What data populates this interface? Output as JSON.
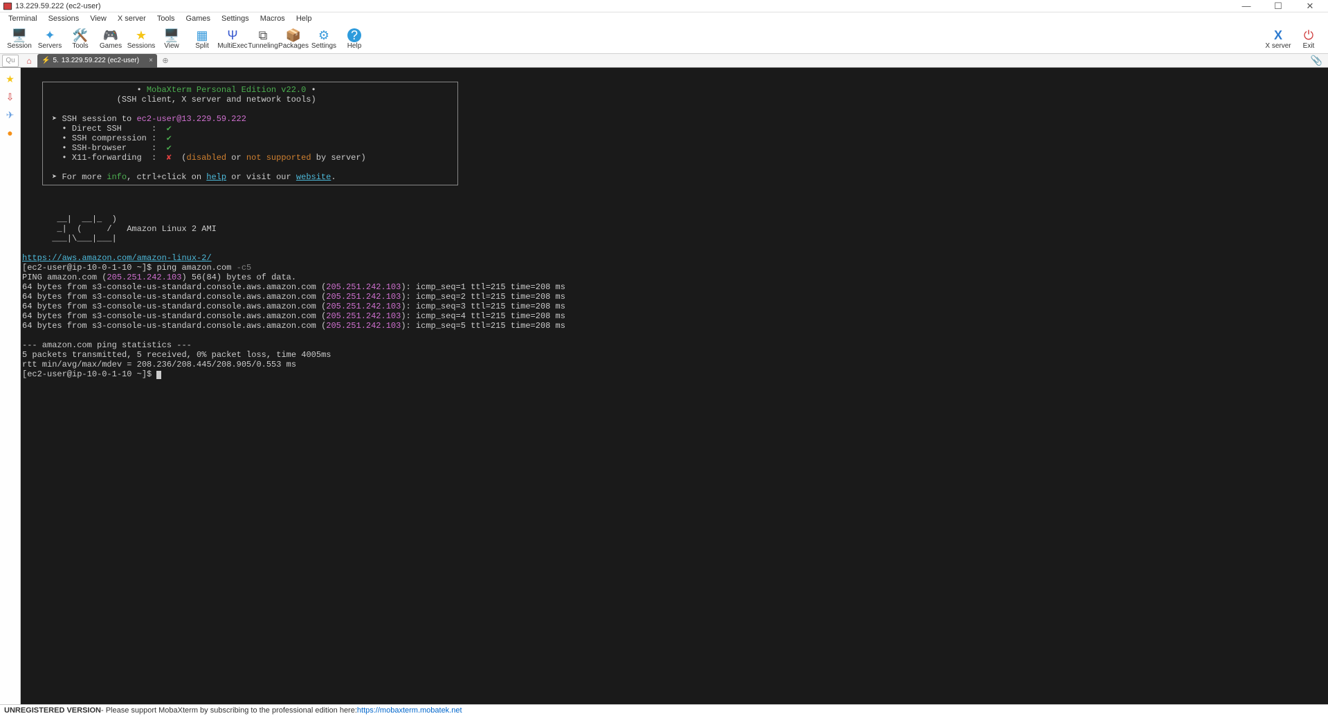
{
  "window": {
    "title": "13.229.59.222 (ec2-user)"
  },
  "menu": [
    "Terminal",
    "Sessions",
    "View",
    "X server",
    "Tools",
    "Games",
    "Settings",
    "Macros",
    "Help"
  ],
  "toolbar_left": [
    {
      "icon": "🖥️",
      "label": "Session",
      "color": "#2e7bcf"
    },
    {
      "icon": "✦",
      "label": "Servers",
      "color": "#3a9bdc"
    },
    {
      "icon": "🛠️",
      "label": "Tools",
      "color": "#d04040"
    },
    {
      "icon": "🎮",
      "label": "Games",
      "color": "#888"
    },
    {
      "icon": "★",
      "label": "Sessions",
      "color": "#f5c518"
    },
    {
      "icon": "🖥️",
      "label": "View",
      "color": "#555"
    },
    {
      "icon": "▦",
      "label": "Split",
      "color": "#3a9bdc"
    },
    {
      "icon": "Ψ",
      "label": "MultiExec",
      "color": "#3a5bcf"
    },
    {
      "icon": "⧉",
      "label": "Tunneling",
      "color": "#555"
    },
    {
      "icon": "📦",
      "label": "Packages",
      "color": "#7a5bcf"
    },
    {
      "icon": "⚙",
      "label": "Settings",
      "color": "#3a9bdc"
    },
    {
      "icon": "?",
      "label": "Help",
      "color": "#ffffff"
    }
  ],
  "toolbar_right": [
    {
      "icon": "X",
      "label": "X server",
      "color": "#2e7bcf"
    },
    {
      "icon": "⏻",
      "label": "Exit",
      "color": "#d04040"
    }
  ],
  "tabs": {
    "quick_placeholder": "Qu",
    "home_icon": "⌂",
    "active": {
      "index": "5.",
      "title": "13.229.59.222 (ec2-user)"
    },
    "clip_icon": "📎"
  },
  "side_icons": [
    {
      "glyph": "★",
      "color": "#f5c518"
    },
    {
      "glyph": "⇩",
      "color": "#d04040"
    },
    {
      "glyph": "✈",
      "color": "#6aa0e0"
    },
    {
      "glyph": "●",
      "color": "#f59018"
    }
  ],
  "banner": {
    "l1_pre": "    • ",
    "l1_mid": "MobaXterm Personal Edition v22.0",
    "l1_post": " •    ",
    "l2": "(SSH client, X server and network tools)",
    "ssh_line_pre": " ➤ SSH session to ",
    "ssh_target": "ec2-user@13.229.59.222",
    "bullets": [
      {
        "label": "Direct SSH      :  ",
        "mark": "✔",
        "ok": true,
        "extra": ""
      },
      {
        "label": "SSH compression :  ",
        "mark": "✔",
        "ok": true,
        "extra": ""
      },
      {
        "label": "SSH-browser     :  ",
        "mark": "✔",
        "ok": true,
        "extra": ""
      },
      {
        "label": "X11-forwarding  :  ",
        "mark": "✘",
        "ok": false,
        "extra": "  (disabled or not supported by server)",
        "extra_parts": {
          "p1": "  (",
          "p2": "disabled",
          "p3": " or ",
          "p4": "not supported",
          "p5": " by server)"
        }
      }
    ],
    "info_pre": " ➤ For more ",
    "info_word": "info",
    "info_mid": ", ctrl+click on ",
    "help_word": "help",
    "info_mid2": " or visit our ",
    "website_word": "website",
    "info_end": "."
  },
  "ascii": {
    "l1": "       __|  __|_  )",
    "l2": "       _|  (     /   Amazon Linux 2 AMI",
    "l3": "      ___|\\___|___|"
  },
  "term": {
    "link": "https://aws.amazon.com/amazon-linux-2/",
    "prompt": "[ec2-user@ip-10-0-1-10 ~]$ ",
    "cmd": "ping amazon.com -c5",
    "ping_header_pre": "PING amazon.com (",
    "ping_ip1": "205.251.242.103",
    "ping_header_post": ") 56(84) bytes of data.",
    "replies": [
      "64 bytes from s3-console-us-standard.console.aws.amazon.com (205.251.242.103): icmp_seq=1 ttl=215 time=208 ms",
      "64 bytes from s3-console-us-standard.console.aws.amazon.com (205.251.242.103): icmp_seq=2 ttl=215 time=208 ms",
      "64 bytes from s3-console-us-standard.console.aws.amazon.com (205.251.242.103): icmp_seq=3 ttl=215 time=208 ms",
      "64 bytes from s3-console-us-standard.console.aws.amazon.com (205.251.242.103): icmp_seq=4 ttl=215 time=208 ms",
      "64 bytes from s3-console-us-standard.console.aws.amazon.com (205.251.242.103): icmp_seq=5 ttl=215 time=208 ms"
    ],
    "reply_pre": "64 bytes from s3-console-us-standard.console.aws.amazon.com (",
    "reply_ip": "205.251.242.103",
    "reply_posts": [
      "): icmp_seq=1 ttl=215 time=208 ms",
      "): icmp_seq=2 ttl=215 time=208 ms",
      "): icmp_seq=3 ttl=215 time=208 ms",
      "): icmp_seq=4 ttl=215 time=208 ms",
      "): icmp_seq=5 ttl=215 time=208 ms"
    ],
    "stats_hd_pre": "--- amazon.com ping statistics ---",
    "stats_l1": "5 packets transmitted, 5 received, 0% packet loss, time 4005ms",
    "stats_l2": "rtt min/avg/max/mdev = 208.236/208.445/208.905/0.553 ms",
    "prompt2": "[ec2-user@ip-10-0-1-10 ~]$ "
  },
  "status": {
    "bold": "UNREGISTERED VERSION",
    "text": " -  Please support MobaXterm by subscribing to the professional edition here:  ",
    "link": "https://mobaxterm.mobatek.net"
  }
}
